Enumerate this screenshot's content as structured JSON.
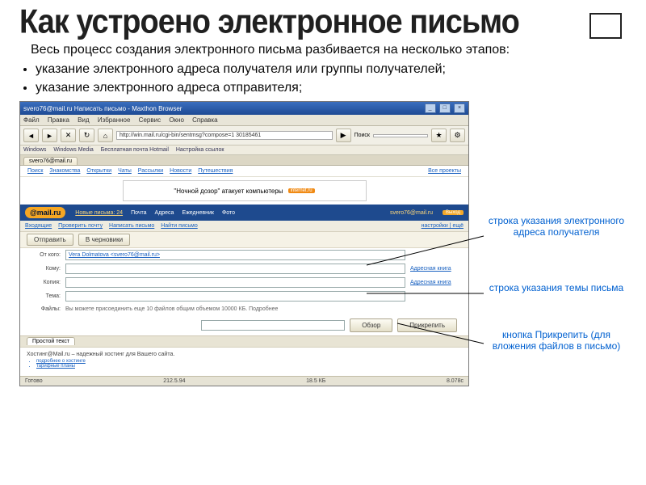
{
  "title": "Как устроено электронное письмо",
  "intro": "Весь процесс создания электронного письма разбивается на несколько этапов:",
  "bullets": [
    "указание электронного адреса получателя или группы получателей;",
    "указание электронного адреса отправителя;"
  ],
  "browser": {
    "window_title": "svero76@mail.ru Написать письмо - Maxthon Browser",
    "menu": [
      "Файл",
      "Правка",
      "Вид",
      "Избранное",
      "Сервис",
      "Окно",
      "Справка"
    ],
    "url": "http://win.mail.ru/cgi-bin/sentmsg?compose=1 30185461",
    "search_label": "Поиск",
    "bookmarks": [
      "Windows",
      "Windows Media",
      "Бесплатная почта Hotmail",
      "Настройка ссылок"
    ],
    "tab": "svero76@mail.ru"
  },
  "portal_nav": {
    "links": [
      "Поиск",
      "Знакомства",
      "Открытки",
      "Чаты",
      "Рассылки",
      "Новости",
      "Путешествия"
    ],
    "all": "Все проекты"
  },
  "banner": {
    "text": "\"Ночной дозор\" атакует компьютеры",
    "brand": "internet.ru"
  },
  "mail_header": {
    "logo": "@mail.ru",
    "new_link": "Новые письма: 24",
    "nav": [
      "Почта",
      "Адреса",
      "Ежедневник",
      "Фото"
    ],
    "user": "svero76@mail.ru",
    "exit": "Выход"
  },
  "mail_toolbar": {
    "links": [
      "Входящие",
      "Проверить почту",
      "Написать письмо",
      "Найти письмо"
    ],
    "right": "настройки | ещё"
  },
  "compose": {
    "send": "Отправить",
    "draft": "В черновики",
    "from_label": "От кого:",
    "from_value": "Vera Dolmatova <svero76@mail.ru>",
    "to_label": "Кому:",
    "cc_label": "Копия:",
    "subj_label": "Тема:",
    "addr_link": "Адресная книга",
    "files_label": "Файлы:",
    "files_hint": "Вы можете присоединить еще 10 файлов общим объемом 10000 КБ. Подробнее",
    "browse": "Обзор",
    "attach": "Прикрепить",
    "editor_tab": "Простой текст"
  },
  "footer": {
    "msg": "Хостинг@Mail.ru – надежный хостинг для Вашего сайта.",
    "status_l": "Готово",
    "status_m": "212.5.94",
    "status_r": "18.5 КБ",
    "status_t": "8.078с"
  },
  "callouts": {
    "c1": "строка указания электронного адреса получателя",
    "c2": "строка указания темы письма",
    "c3": "кнопка Прикрепить (для вложения файлов в письмо)"
  }
}
